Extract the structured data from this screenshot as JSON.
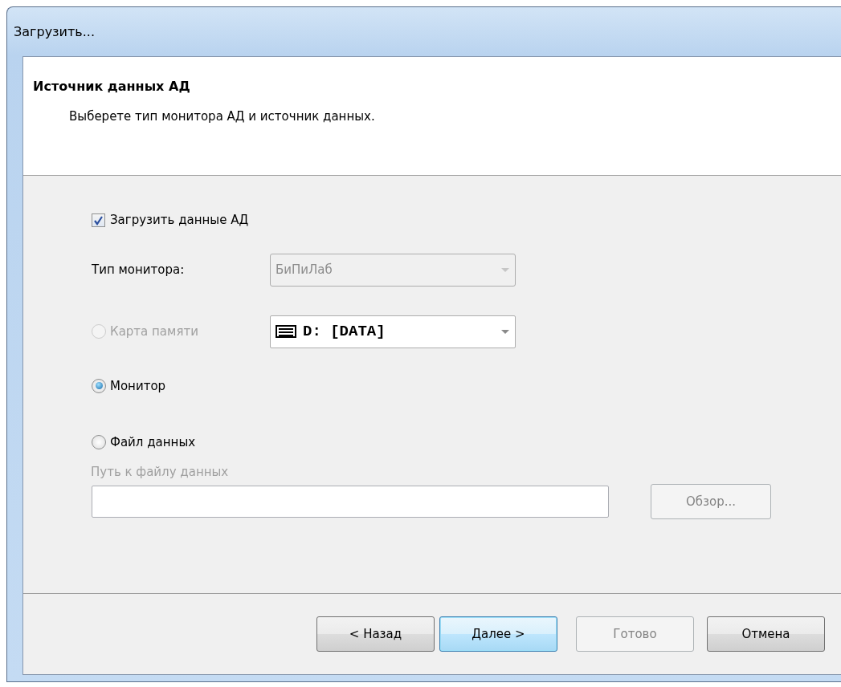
{
  "window": {
    "title": "Загрузить..."
  },
  "header": {
    "title": "Источник данных АД",
    "subtitle": "Выберете тип монитора АД и источник данных."
  },
  "load_checkbox": {
    "label": "Загрузить данные АД",
    "checked": true
  },
  "monitor_type": {
    "label": "Тип монитора:",
    "value": "БиПиЛаб",
    "disabled": true
  },
  "sources": [
    {
      "label": "Карта памяти",
      "selected": false,
      "disabled": true,
      "kind": "drive"
    },
    {
      "label": "Монитор",
      "selected": true,
      "disabled": false,
      "kind": "plain"
    },
    {
      "label": "Файл данных",
      "selected": false,
      "disabled": false,
      "kind": "plain"
    }
  ],
  "drive_select": {
    "value": "D: [DATA]",
    "disabled": false
  },
  "path": {
    "label": "Путь к файлу данных",
    "disabled": true
  },
  "browse_button": {
    "label": "Обзор...",
    "disabled": true
  },
  "buttons": [
    {
      "label": "< Назад",
      "default": false,
      "disabled": false
    },
    {
      "label": "Далее >",
      "default": true,
      "disabled": false
    },
    {
      "label": "Готово",
      "default": false,
      "disabled": true
    },
    {
      "label": "Отмена",
      "default": false,
      "disabled": false
    }
  ]
}
